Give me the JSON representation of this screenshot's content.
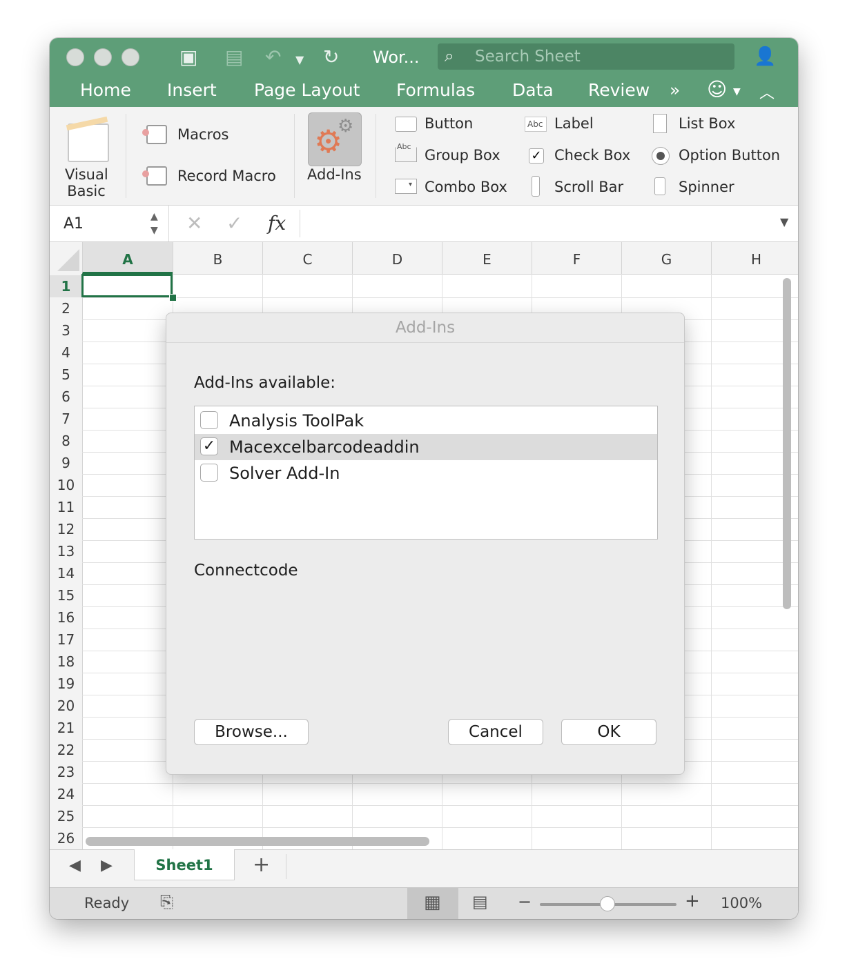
{
  "titlebar": {
    "doc_title": "Wor...",
    "search_placeholder": "Search Sheet"
  },
  "tabs": [
    "Home",
    "Insert",
    "Page Layout",
    "Formulas",
    "Data",
    "Review"
  ],
  "ribbon": {
    "visual_basic": "Visual Basic",
    "macros": "Macros",
    "record_macro": "Record Macro",
    "addins": "Add-Ins",
    "controls": {
      "button": "Button",
      "label": "Label",
      "list_box": "List Box",
      "group_box": "Group Box",
      "check_box": "Check Box",
      "option_button": "Option Button",
      "combo_box": "Combo Box",
      "scroll_bar": "Scroll Bar",
      "spinner": "Spinner",
      "abc_text": "Abc"
    }
  },
  "formula_bar": {
    "name_box": "A1",
    "fx": "fx",
    "formula": ""
  },
  "grid": {
    "columns": [
      "A",
      "B",
      "C",
      "D",
      "E",
      "F",
      "G",
      "H"
    ],
    "rows": [
      "1",
      "2",
      "3",
      "4",
      "5",
      "6",
      "7",
      "8",
      "9",
      "10",
      "11",
      "12",
      "13",
      "14",
      "15",
      "16",
      "17",
      "18",
      "19",
      "20",
      "21",
      "22",
      "23",
      "24",
      "25",
      "26"
    ],
    "active_cell": "A1"
  },
  "sheets": {
    "tabs": [
      "Sheet1"
    ],
    "add": "+"
  },
  "status": {
    "text": "Ready",
    "zoom": "100%",
    "zoom_minus": "−",
    "zoom_plus": "+"
  },
  "dialog": {
    "title": "Add-Ins",
    "available_label": "Add-Ins available:",
    "addins": [
      {
        "name": "Analysis ToolPak",
        "checked": false
      },
      {
        "name": "Macexcelbarcodeaddin",
        "checked": true
      },
      {
        "name": "Solver Add-In",
        "checked": false
      }
    ],
    "description": "Connectcode",
    "browse_label": "Browse...",
    "cancel_label": "Cancel",
    "ok_label": "OK"
  },
  "colors": {
    "title_green": "#5e9e78",
    "excel_green": "#217346"
  }
}
